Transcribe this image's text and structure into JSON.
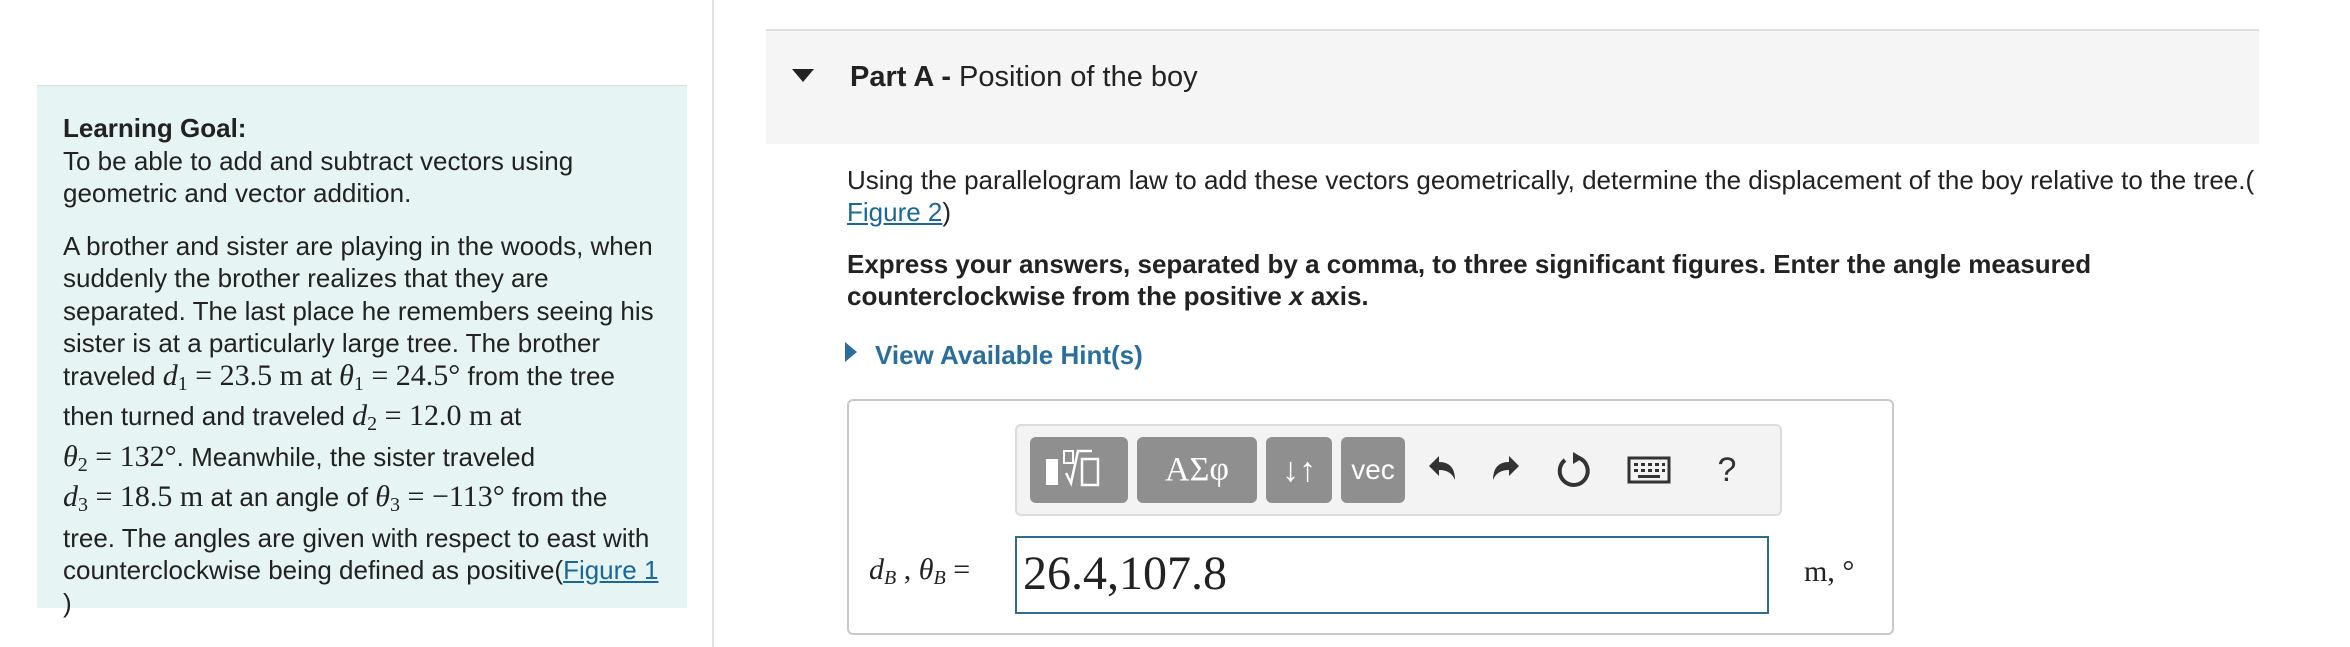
{
  "left_panel": {
    "goal_title": "Learning Goal:",
    "goal_text": "To be able to add and subtract vectors using geometric and vector addition.",
    "problem": {
      "l1": "A brother and sister are playing in the woods, when",
      "l2": "suddenly the brother realizes that they are",
      "l3": "separated. The last place he remembers seeing his",
      "l4": "sister is at a particularly large tree. The brother",
      "l5_a": "traveled ",
      "d1": "d",
      "d1_sub": "1",
      "d1_eq": " = 23.5 m",
      "l5_b": " at ",
      "theta1": "θ",
      "theta1_sub": "1",
      "theta1_eq": " = 24.5°",
      "l5_c": " from the tree",
      "l6_a": "then turned and traveled ",
      "d2": "d",
      "d2_sub": "2",
      "d2_eq": " = 12.0 m",
      "l6_b": " at",
      "theta2": "θ",
      "theta2_sub": "2",
      "theta2_eq": " = 132°",
      "l7_b": ". Meanwhile, the sister traveled",
      "d3": "d",
      "d3_sub": "3",
      "d3_eq": " = 18.5 m",
      "l8_b": " at an angle of ",
      "theta3": "θ",
      "theta3_sub": "3",
      "theta3_eq": " = −113°",
      "l8_c": " from the",
      "l9": "tree. The angles are given with respect to east with",
      "l10_a": "counterclockwise being defined as positive(",
      "figure1_link": "Figure 1",
      "l11": ")"
    }
  },
  "part": {
    "label": "Part A -",
    "title": " Position of the boy"
  },
  "question": {
    "text": "Using the parallelogram law to add these vectors geometrically, determine the displacement of the boy relative to the tree.(",
    "figure2_link": "Figure 2",
    "close": ")"
  },
  "instructions": {
    "text_a": "Express your answers, separated by a comma, to three significant figures. Enter the angle measured counterclockwise from the positive ",
    "x": "x",
    "text_b": " axis."
  },
  "hints": {
    "label": "View Available Hint(s)"
  },
  "toolbar": {
    "greek_label": "ΑΣφ",
    "arrows_label": "↓↑",
    "vec_label": "vec",
    "help_label": "?"
  },
  "answer": {
    "label_d": "d",
    "label_d_sub": "B",
    "label_sep": " , ",
    "label_theta": "θ",
    "label_theta_sub": "B",
    "label_eq": " =",
    "value": "26.4,107.8",
    "units": "m, °"
  }
}
